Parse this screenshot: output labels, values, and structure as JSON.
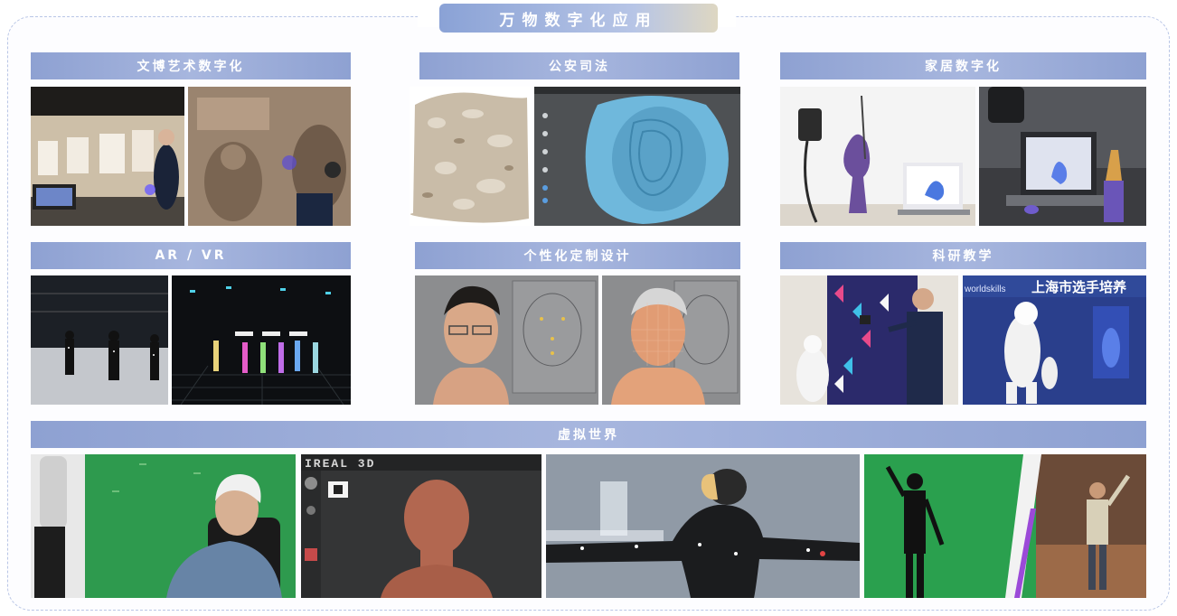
{
  "main_title": "万物数字化应用",
  "sections": {
    "culture": "文博艺术数字化",
    "police": "公安司法",
    "home": "家居数字化",
    "arvr": "AR / VR",
    "custom": "个性化定制设计",
    "science": "科研教学",
    "virtual": "虚拟世界"
  },
  "photo_texts": {
    "worldskills": "worldskills",
    "shanghai": "上海市选手培养",
    "ireal": "IREAL 3D"
  }
}
